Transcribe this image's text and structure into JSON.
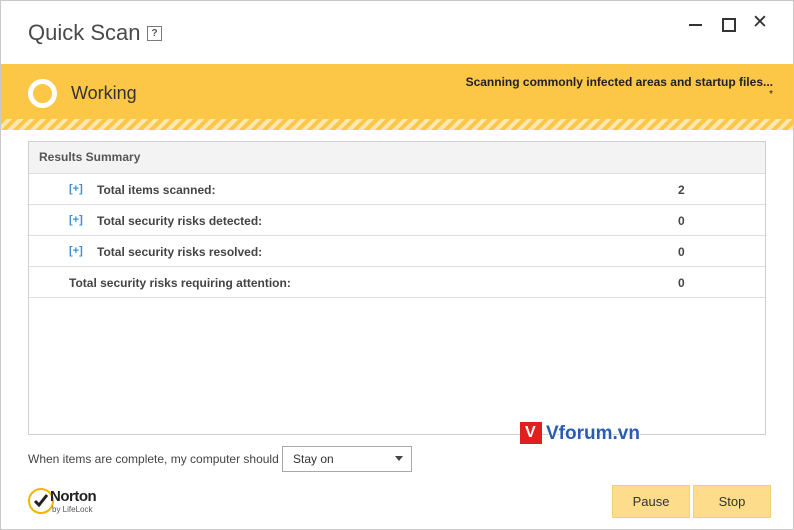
{
  "window": {
    "title": "Quick Scan",
    "help_label": "?",
    "controls": {
      "minimize": "minimize",
      "maximize": "maximize",
      "close": "✕"
    }
  },
  "status": {
    "state": "Working",
    "detail": "Scanning commonly infected areas and startup files...",
    "marker": "*",
    "accent_color": "#fcc646"
  },
  "results": {
    "header": "Results Summary",
    "rows": [
      {
        "expander": "[+]",
        "label": "Total items scanned:",
        "value": "2"
      },
      {
        "expander": "[+]",
        "label": "Total security risks detected:",
        "value": "0"
      },
      {
        "expander": "[+]",
        "label": "Total security risks resolved:",
        "value": "0"
      },
      {
        "expander": "",
        "label": "Total security risks requiring attention:",
        "value": "0"
      }
    ]
  },
  "footer": {
    "complete_label": "When items are complete, my computer should",
    "action_select": {
      "value": "Stay on"
    },
    "pause_label": "Pause",
    "stop_label": "Stop"
  },
  "branding": {
    "logo_word": "Norton",
    "logo_sub": "by LifeLock",
    "watermark": "Vforum.vn",
    "watermark_mark": "V"
  }
}
